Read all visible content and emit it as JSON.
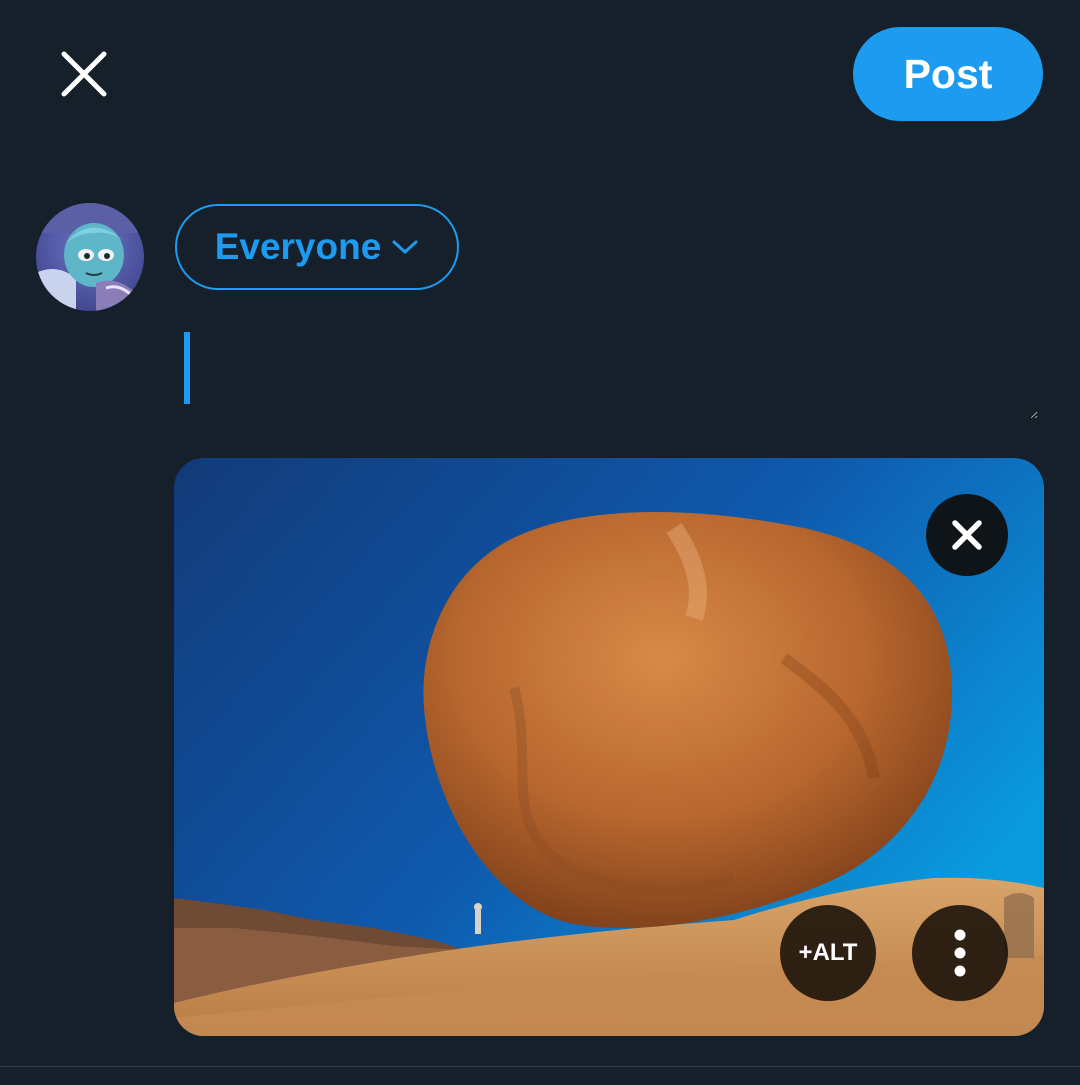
{
  "header": {
    "close_icon": "close-icon",
    "post_label": "Post"
  },
  "composer": {
    "audience_label": "Everyone",
    "audience_icon": "chevron-down-icon",
    "text_value": "",
    "avatar_icon": "avatar"
  },
  "media": {
    "remove_icon": "close-icon",
    "alt_label": "+ALT",
    "more_icon": "more-vertical-icon"
  },
  "colors": {
    "background": "#15202b",
    "accent": "#1d9bf0"
  }
}
